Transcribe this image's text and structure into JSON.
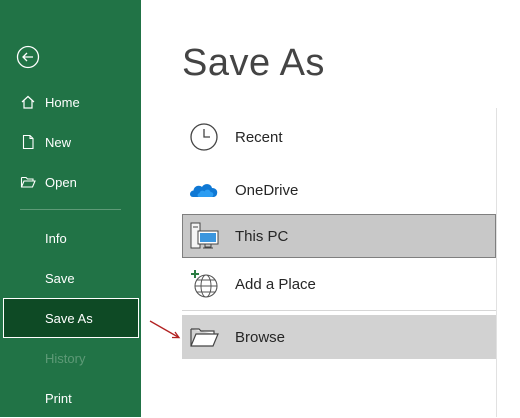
{
  "sidebar": {
    "back_icon": "back-arrow-icon",
    "items": [
      {
        "label": "Home",
        "icon": "home-icon"
      },
      {
        "label": "New",
        "icon": "new-document-icon"
      },
      {
        "label": "Open",
        "icon": "open-folder-icon"
      },
      {
        "label": "Info"
      },
      {
        "label": "Save"
      },
      {
        "label": "Save As",
        "selected": true
      },
      {
        "label": "History",
        "disabled": true
      },
      {
        "label": "Print"
      }
    ]
  },
  "main": {
    "title": "Save As",
    "locations": [
      {
        "label": "Recent",
        "icon": "clock-icon"
      },
      {
        "label": "OneDrive",
        "icon": "onedrive-cloud-icon"
      },
      {
        "label": "This PC",
        "icon": "this-pc-icon",
        "selected": true
      },
      {
        "label": "Add a Place",
        "icon": "add-place-globe-icon"
      },
      {
        "label": "Browse",
        "icon": "browse-folder-icon"
      }
    ]
  },
  "colors": {
    "sidebar_bg": "#217346",
    "sidebar_selected": "#0e4a25",
    "selected_location_bg": "#c8c8c8",
    "arrow_annotation": "#b22222"
  }
}
